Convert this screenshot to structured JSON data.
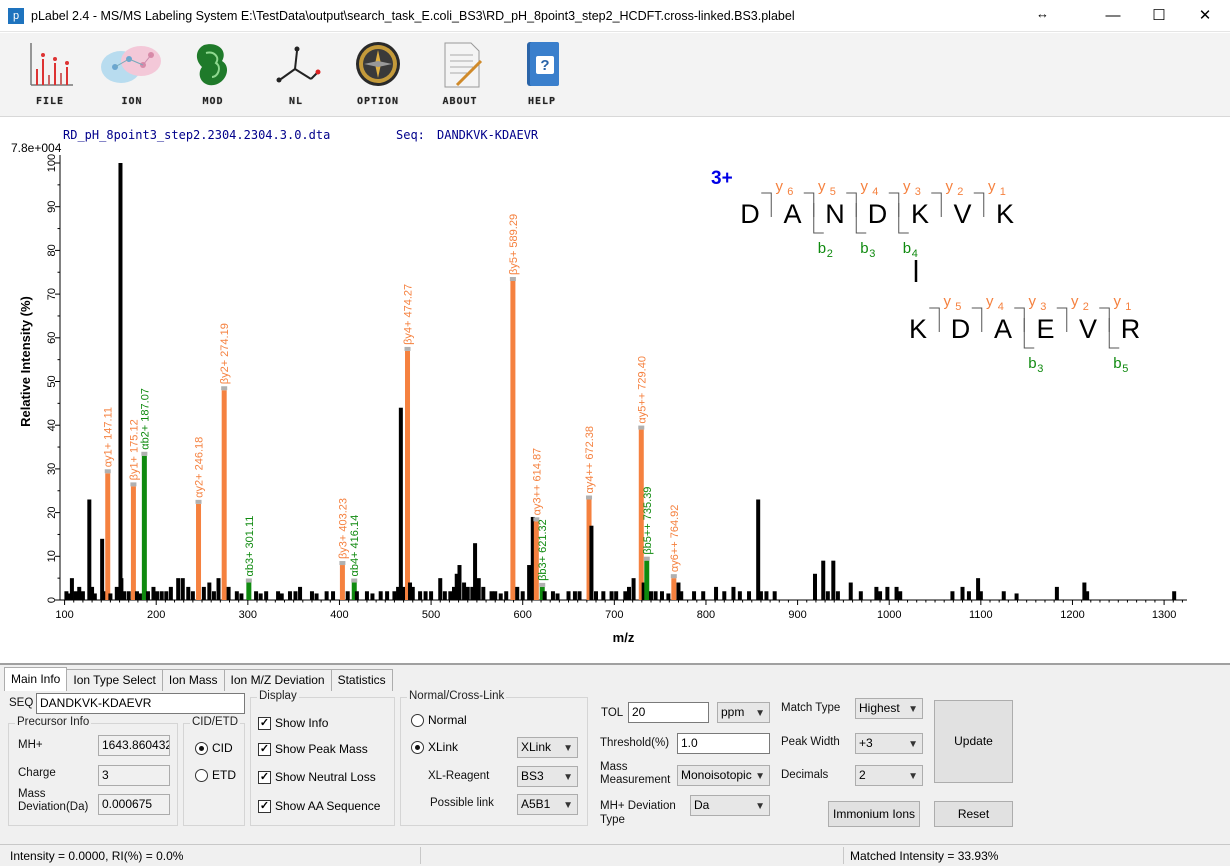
{
  "window": {
    "title": "pLabel 2.4 - MS/MS Labeling System E:\\TestData\\output\\search_task_E.coli_BS3\\RD_pH_8point3_step2_HCDFT.cross-linked.BS3.plabel",
    "app_icon": "p",
    "resize_glyph": "↔",
    "minimize": "—",
    "maximize": "☐",
    "close": "✕"
  },
  "toolbar": {
    "items": [
      {
        "label": "FILE",
        "icon": "spectrum-file-icon"
      },
      {
        "label": "ION",
        "icon": "ion-network-icon"
      },
      {
        "label": "MOD",
        "icon": "modification-icon"
      },
      {
        "label": "NL",
        "icon": "neutral-loss-molecule-icon"
      },
      {
        "label": "OPTION",
        "icon": "compass-option-icon"
      },
      {
        "label": "ABOUT",
        "icon": "document-about-icon"
      },
      {
        "label": "HELP",
        "icon": "help-book-icon"
      }
    ]
  },
  "spectrum": {
    "file_name": "RD_pH_8point3_step2.2304.2304.3.0.dta",
    "seq_label": "Seq:",
    "seq_value": "DANDKVK-KDAEVR",
    "max_intensity_label": "7.8e+004",
    "charge": "3+",
    "peptide1": {
      "residues": [
        "D",
        "A",
        "N",
        "D",
        "K",
        "V",
        "K"
      ],
      "y_ions": [
        "y6",
        "y5",
        "y4",
        "y3",
        "y2",
        "y1"
      ],
      "b_ions": [
        "b2",
        "b3",
        "b4"
      ]
    },
    "peptide2": {
      "residues": [
        "K",
        "D",
        "A",
        "E",
        "V",
        "R"
      ],
      "y_ions": [
        "y5",
        "y4",
        "y3",
        "y2",
        "y1"
      ],
      "b_ions": [
        "b3",
        "b5"
      ]
    }
  },
  "chart_data": {
    "type": "bar",
    "title": "",
    "xlabel": "m/z",
    "ylabel": "Relative   Intensity (%)",
    "xlim": [
      95,
      1325
    ],
    "ylim": [
      0,
      100
    ],
    "xticks": [
      100,
      200,
      300,
      400,
      500,
      600,
      700,
      800,
      900,
      1000,
      1100,
      1200,
      1300
    ],
    "yticks": [
      0,
      10,
      20,
      30,
      40,
      50,
      60,
      70,
      80,
      90,
      100
    ],
    "colors": {
      "unmatched": "#000000",
      "y": "#f5813f",
      "b": "#0f8a0f",
      "seq": "#00008b",
      "charge": "#0000e6",
      "label_cap": "#b0b0b0"
    },
    "peaks": [
      [
        102,
        2
      ],
      [
        105,
        1.5
      ],
      [
        108,
        5
      ],
      [
        112,
        2
      ],
      [
        116,
        3
      ],
      [
        120,
        2
      ],
      [
        127,
        23
      ],
      [
        130,
        3
      ],
      [
        133,
        1.5
      ],
      [
        141,
        14
      ],
      [
        145,
        2
      ],
      [
        147.11,
        29
      ],
      [
        150,
        1.5
      ],
      [
        157,
        3
      ],
      [
        161,
        100
      ],
      [
        162,
        5
      ],
      [
        165,
        2
      ],
      [
        170,
        2
      ],
      [
        175.12,
        26
      ],
      [
        179,
        2
      ],
      [
        183,
        1.5
      ],
      [
        187.07,
        33
      ],
      [
        191,
        2
      ],
      [
        197,
        3
      ],
      [
        201,
        2
      ],
      [
        206,
        2
      ],
      [
        211,
        2
      ],
      [
        216,
        3
      ],
      [
        224,
        5
      ],
      [
        229,
        5
      ],
      [
        235,
        3
      ],
      [
        240,
        2
      ],
      [
        246.18,
        22
      ],
      [
        252,
        3
      ],
      [
        258,
        4
      ],
      [
        263,
        2
      ],
      [
        268,
        5
      ],
      [
        274.19,
        48
      ],
      [
        279,
        3
      ],
      [
        288,
        2
      ],
      [
        293,
        1.5
      ],
      [
        301.11,
        4
      ],
      [
        309,
        2
      ],
      [
        314,
        1.5
      ],
      [
        320,
        2
      ],
      [
        333,
        2
      ],
      [
        337,
        1.5
      ],
      [
        346,
        2
      ],
      [
        352,
        2
      ],
      [
        357,
        3
      ],
      [
        370,
        2
      ],
      [
        375,
        1.5
      ],
      [
        386,
        2
      ],
      [
        393,
        2
      ],
      [
        403.23,
        8
      ],
      [
        409,
        2
      ],
      [
        416.14,
        4
      ],
      [
        419,
        2
      ],
      [
        430,
        2
      ],
      [
        436,
        1.5
      ],
      [
        445,
        2
      ],
      [
        452,
        2
      ],
      [
        460,
        2
      ],
      [
        464,
        3
      ],
      [
        467,
        44
      ],
      [
        470,
        3
      ],
      [
        474.27,
        57
      ],
      [
        477,
        4
      ],
      [
        480,
        3
      ],
      [
        488,
        2
      ],
      [
        494,
        2
      ],
      [
        500,
        2
      ],
      [
        510,
        5
      ],
      [
        515,
        2
      ],
      [
        521,
        2
      ],
      [
        525,
        3
      ],
      [
        528,
        6
      ],
      [
        531,
        8
      ],
      [
        536,
        4
      ],
      [
        540,
        3
      ],
      [
        545,
        3
      ],
      [
        548,
        13
      ],
      [
        552,
        5
      ],
      [
        557,
        3
      ],
      [
        566,
        2
      ],
      [
        570,
        2
      ],
      [
        576,
        1.5
      ],
      [
        582,
        2
      ],
      [
        589.29,
        73
      ],
      [
        594,
        3
      ],
      [
        600,
        2
      ],
      [
        607,
        8
      ],
      [
        611,
        19
      ],
      [
        614.87,
        18
      ],
      [
        621.32,
        3
      ],
      [
        624,
        2
      ],
      [
        633,
        2
      ],
      [
        638,
        1.5
      ],
      [
        650,
        2
      ],
      [
        657,
        2
      ],
      [
        662,
        2
      ],
      [
        672.38,
        23
      ],
      [
        675,
        17
      ],
      [
        680,
        2
      ],
      [
        688,
        2
      ],
      [
        697,
        2
      ],
      [
        702,
        2
      ],
      [
        712,
        2
      ],
      [
        716,
        3
      ],
      [
        721,
        5
      ],
      [
        729.4,
        39
      ],
      [
        732,
        4
      ],
      [
        735.39,
        9
      ],
      [
        740,
        2
      ],
      [
        745,
        2
      ],
      [
        752,
        2
      ],
      [
        759,
        1.5
      ],
      [
        764.92,
        5
      ],
      [
        770,
        4
      ],
      [
        773,
        2
      ],
      [
        787,
        2
      ],
      [
        797,
        2
      ],
      [
        811,
        3
      ],
      [
        820,
        2
      ],
      [
        830,
        3
      ],
      [
        837,
        2
      ],
      [
        847,
        2
      ],
      [
        857,
        23
      ],
      [
        860,
        2
      ],
      [
        866,
        2
      ],
      [
        875,
        2
      ],
      [
        919,
        6
      ],
      [
        928,
        9
      ],
      [
        933,
        2
      ],
      [
        939,
        9
      ],
      [
        944,
        2
      ],
      [
        958,
        4
      ],
      [
        969,
        2
      ],
      [
        986,
        3
      ],
      [
        990,
        2
      ],
      [
        998,
        3
      ],
      [
        1008,
        3
      ],
      [
        1012,
        2
      ],
      [
        1069,
        2
      ],
      [
        1080,
        3
      ],
      [
        1087,
        2
      ],
      [
        1097,
        5
      ],
      [
        1100,
        2
      ],
      [
        1125,
        2
      ],
      [
        1139,
        1.5
      ],
      [
        1183,
        3
      ],
      [
        1213,
        4
      ],
      [
        1216,
        2
      ],
      [
        1311,
        2
      ]
    ],
    "annotations": [
      {
        "mz": 147.11,
        "y": 29,
        "label": "αy1+ 147.11",
        "type": "y"
      },
      {
        "mz": 175.12,
        "y": 26,
        "label": "βy1+ 175.12",
        "type": "y"
      },
      {
        "mz": 187.07,
        "y": 33,
        "label": "αb2+ 187.07",
        "type": "b"
      },
      {
        "mz": 246.18,
        "y": 22,
        "label": "αy2+ 246.18",
        "type": "y"
      },
      {
        "mz": 274.19,
        "y": 48,
        "label": "βy2+ 274.19",
        "type": "y"
      },
      {
        "mz": 301.11,
        "y": 4,
        "label": "αb3+ 301.11",
        "type": "b"
      },
      {
        "mz": 403.23,
        "y": 8,
        "label": "βy3+ 403.23",
        "type": "y"
      },
      {
        "mz": 416.14,
        "y": 4,
        "label": "αb4+ 416.14",
        "type": "b"
      },
      {
        "mz": 474.27,
        "y": 57,
        "label": "βy4+ 474.27",
        "type": "y"
      },
      {
        "mz": 589.29,
        "y": 73,
        "label": "βy5+ 589.29",
        "type": "y"
      },
      {
        "mz": 614.87,
        "y": 18,
        "label": "αy3++ 614.87",
        "type": "y"
      },
      {
        "mz": 621.32,
        "y": 3,
        "label": "βb3+ 621.32",
        "type": "b"
      },
      {
        "mz": 672.38,
        "y": 23,
        "label": "αy4++ 672.38",
        "type": "y"
      },
      {
        "mz": 729.4,
        "y": 39,
        "label": "αy5++ 729.40",
        "type": "y"
      },
      {
        "mz": 735.39,
        "y": 9,
        "label": "βb5++ 735.39",
        "type": "b"
      },
      {
        "mz": 764.92,
        "y": 5,
        "label": "αy6++ 764.92",
        "type": "y"
      }
    ]
  },
  "tabs": [
    "Main Info",
    "Ion Type Select",
    "Ion Mass",
    "Ion M/Z Deviation",
    "Statistics"
  ],
  "main_info": {
    "seq_label": "SEQ",
    "seq_value": "DANDKVK-KDAEVR",
    "precursor_legend": "Precursor Info",
    "mh_label": "MH+",
    "mh_value": "1643.860432",
    "charge_label": "Charge",
    "charge_value": "3",
    "mass_dev_label_1": "Mass",
    "mass_dev_label_2": "Deviation(Da)",
    "mass_dev_value": "0.000675",
    "cid_etd_legend": "CID/ETD",
    "cid": "CID",
    "etd": "ETD",
    "display_legend": "Display",
    "show_info": "Show Info",
    "show_peak_mass": "Show Peak Mass",
    "show_neutral_loss": "Show Neutral Loss",
    "show_aa_sequence": "Show AA Sequence",
    "nc_legend": "Normal/Cross-Link",
    "normal": "Normal",
    "xlink": "XLink",
    "xlink_select": "XLink",
    "xl_reagent_label": "XL-Reagent",
    "xl_reagent_value": "BS3",
    "possible_link_label": "Possible link",
    "possible_link_value": "A5B1",
    "tol_label": "TOL",
    "tol_value": "20",
    "tol_unit": "ppm",
    "threshold_label": "Threshold(%)",
    "threshold_value": "1.0",
    "mass_meas_label_1": "Mass",
    "mass_meas_label_2": "Measurement",
    "mass_meas_value": "Monoisotopic",
    "mh_dev_label_1": "MH+ Deviation",
    "mh_dev_label_2": "Type",
    "mh_dev_value": "Da",
    "match_type_label": "Match Type",
    "match_type_value": "Highest",
    "peak_width_label": "Peak Width",
    "peak_width_value": "+3",
    "decimals_label": "Decimals",
    "decimals_value": "2",
    "update": "Update",
    "immonium": "Immonium Ions",
    "reset": "Reset"
  },
  "status": {
    "left": "Intensity = 0.0000, RI(%) = 0.0%",
    "right": "Matched Intensity = 33.93%"
  }
}
